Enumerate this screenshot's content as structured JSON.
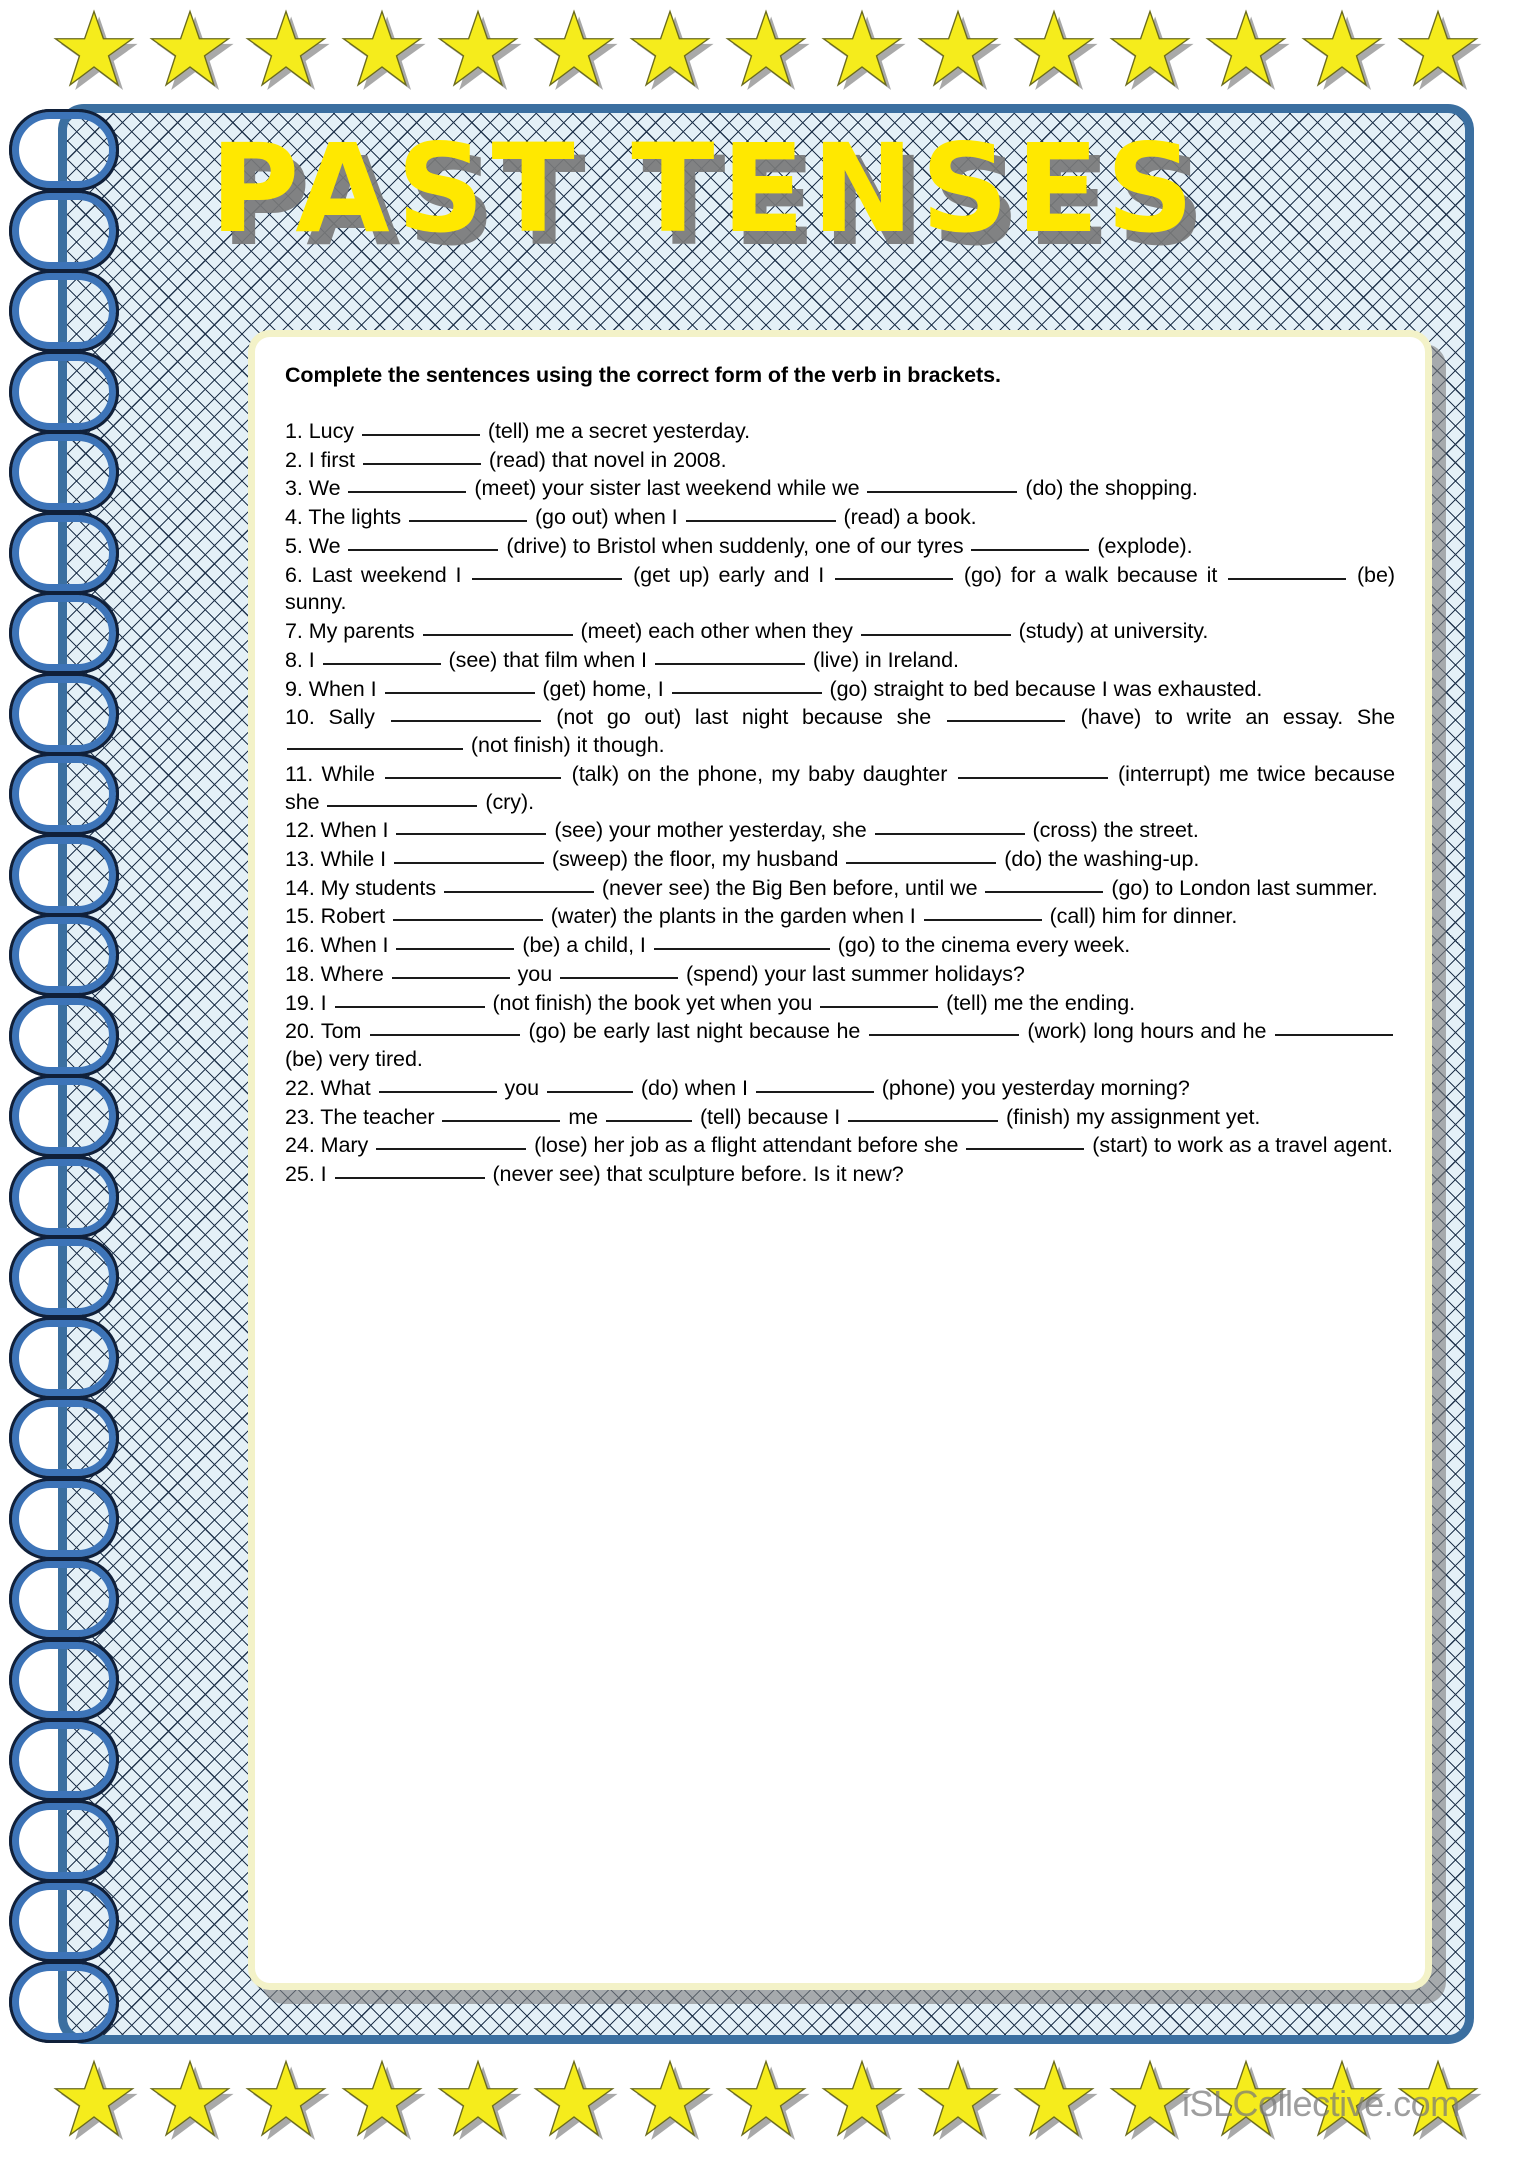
{
  "title": "PAST TENSES",
  "instruction": "Complete the sentences using the correct form of the verb in brackets.",
  "watermark": "iSLCollective.com",
  "decor": {
    "star_icon": "star-icon",
    "top_star_count": 15,
    "bottom_star_count": 15,
    "spiral_ring_count": 24,
    "star_fill": "#f5ec1c",
    "star_outline": "#6b6b1e",
    "star_shadow": "#9a9a9a",
    "frame_border": "#3b6fa0",
    "pattern_bg": "#e4f0f7",
    "pattern_line": "#22354d",
    "ring_blue": "#3d74b8",
    "ring_outline": "#10203a",
    "card_border": "#f3f2c8",
    "title_fill": "#ffe800",
    "title_shadow": "#787878"
  },
  "questions": [
    {
      "n": "1.",
      "text": "1. Lucy ____________ (tell) me a secret yesterday."
    },
    {
      "n": "2.",
      "text": "2. I first ____________ (read) that novel in 2008."
    },
    {
      "n": "3.",
      "text": "3. We _____________ (meet) your sister last weekend while we ________________ (do) the shopping."
    },
    {
      "n": "4.",
      "text": "4. The lights _____________ (go out) when I __________________ (read) a book."
    },
    {
      "n": "5.",
      "text": "5. We ________________ (drive) to Bristol when suddenly, one of our tyres _____________ (explode)."
    },
    {
      "n": "6.",
      "text": "6. Last weekend I _______________ (get up) early and I ____________ (go) for a walk because it ____________ (be) sunny."
    },
    {
      "n": "7.",
      "text": "7. My parents ________________ (meet) each other when they _______________ (study) at university."
    },
    {
      "n": "8.",
      "text": "8. I ______________ (see) that film when I _______________ (live) in Ireland."
    },
    {
      "n": "9.",
      "text": "9. When I _______________ (get) home, I _______________ (go) straight to bed because I was exhausted."
    },
    {
      "n": "10.",
      "text": "10. Sally _________________ (not go out) last night because she ____________ (have) to write an essay. She ____________________ (not finish) it though."
    },
    {
      "n": "11.",
      "text": "11. While ______________________ (talk) on the phone, my baby daughter _______________ (interrupt) me twice because she ________________ (cry)."
    },
    {
      "n": "12.",
      "text": "12. When I ________________ (see) your mother yesterday, she _______________ (cross) the street."
    },
    {
      "n": "13.",
      "text": "13. While I ________________ (sweep) the floor, my husband ________________ (do) the washing-up."
    },
    {
      "n": "14.",
      "text": "14. My students _________________ (never see) the Big Ben before, until we ___________ (go) to London last summer."
    },
    {
      "n": "15.",
      "text": "15. Robert __________________ (water) the plants in the garden when I _____________ (call) him for dinner."
    },
    {
      "n": "16.",
      "text": "16. When I ______________ (be) a child, I ___________________ (go) to the cinema every week."
    },
    {
      "n": "18.",
      "text": "18. Where ___________ you ___________ (spend) your last summer holidays?"
    },
    {
      "n": "19.",
      "text": "19. I __________________ (not finish) the book yet when you _____________ (tell) me the ending."
    },
    {
      "n": "20.",
      "text": "20. Tom _______________ (go) be early last night because he _________________ (work) long hours and he _____________ (be) very tired."
    },
    {
      "n": "22.",
      "text": "22. What ___________ you _________ (do) when I _____________ (phone) you yesterday morning?"
    },
    {
      "n": "23.",
      "text": "23. The teacher ___________ me _________ (tell) because I ________________ (finish) my assignment yet."
    },
    {
      "n": "24.",
      "text": "24. Mary ________________ (lose) her job as a flight attendant before she _____________ (start) to work as a travel agent."
    },
    {
      "n": "25.",
      "text": "25. I ________________ (never see) that sculpture before. Is it new?"
    }
  ]
}
